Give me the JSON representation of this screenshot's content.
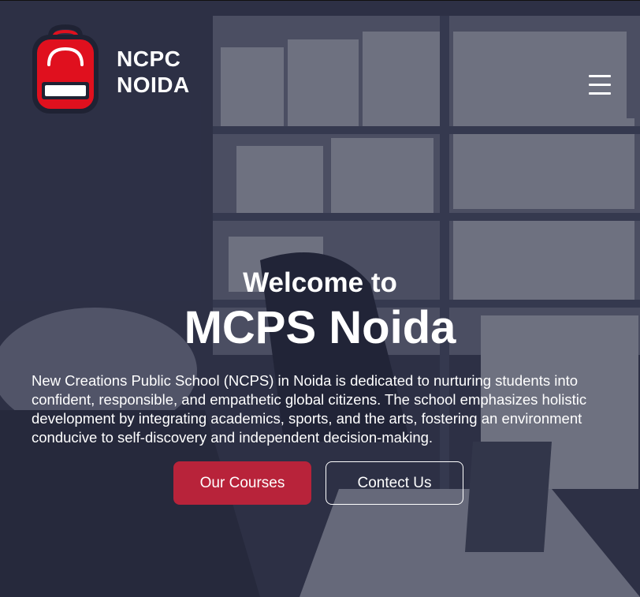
{
  "brand": {
    "line1": "NCPC",
    "line2": "NOIDA",
    "icon": "backpack-icon",
    "accent_color": "#e0101e"
  },
  "nav": {
    "menu_icon": "hamburger-menu-icon"
  },
  "hero": {
    "welcome": "Welcome to",
    "title": "MCPS Noida",
    "description": "New Creations Public School (NCPS) in Noida is dedicated to nurturing students into confident, responsible, and empathetic global citizens. The school emphasizes holistic development by integrating academics, sports, and the arts, fostering an environment conducive to self-discovery and independent decision-making.",
    "primary_button": "Our Courses",
    "secondary_button": "Contect Us",
    "primary_color": "#b8233a"
  }
}
